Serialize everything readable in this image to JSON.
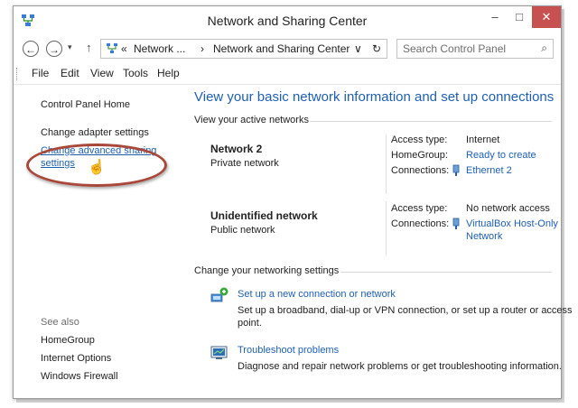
{
  "window": {
    "title": "Network and Sharing Center",
    "minimize": "–",
    "maximize": "□",
    "close": "✕"
  },
  "nav": {
    "back": "←",
    "forward": "→",
    "recent": "▾",
    "up": "↑",
    "crumb_prefix": "«",
    "crumb1": "Network ...",
    "crumb_sep": "›",
    "crumb2": "Network and Sharing Center",
    "dropdown": "∨",
    "refresh": "↻",
    "search_placeholder": "Search Control Panel",
    "search_icon": "⌕"
  },
  "menu": [
    "File",
    "Edit",
    "View",
    "Tools",
    "Help"
  ],
  "sidebar": {
    "home": "Control Panel Home",
    "adapter": "Change adapter settings",
    "advanced_line1": "Change advanced sharing",
    "advanced_line2": "settings",
    "see_also": "See also",
    "homegroup": "HomeGroup",
    "internet_options": "Internet Options",
    "firewall": "Windows Firewall"
  },
  "main": {
    "heading": "View your basic network information and set up connections",
    "active_label": "View your active networks",
    "networks": [
      {
        "name": "Network  2",
        "type": "Private network",
        "access_label": "Access type:",
        "access_value": "Internet",
        "homegroup_label": "HomeGroup:",
        "homegroup_value": "Ready to create",
        "connections_label": "Connections:",
        "connections_value": "Ethernet 2"
      },
      {
        "name": "Unidentified network",
        "type": "Public network",
        "access_label": "Access type:",
        "access_value": "No network access",
        "connections_label": "Connections:",
        "connections_value_line1": "VirtualBox Host-Only",
        "connections_value_line2": "Network"
      }
    ],
    "change_label": "Change your networking settings",
    "tasks": [
      {
        "title": "Set up a new connection or network",
        "desc_line1": "Set up a broadband, dial-up or VPN connection, or set up a router or access",
        "desc_line2": "point."
      },
      {
        "title": "Troubleshoot problems",
        "desc_line1": "Diagnose and repair network problems or get troubleshooting information."
      }
    ]
  },
  "colors": {
    "link": "#1e5fb4",
    "close_button": "#c75050",
    "highlight_oval": "#a9473a"
  }
}
